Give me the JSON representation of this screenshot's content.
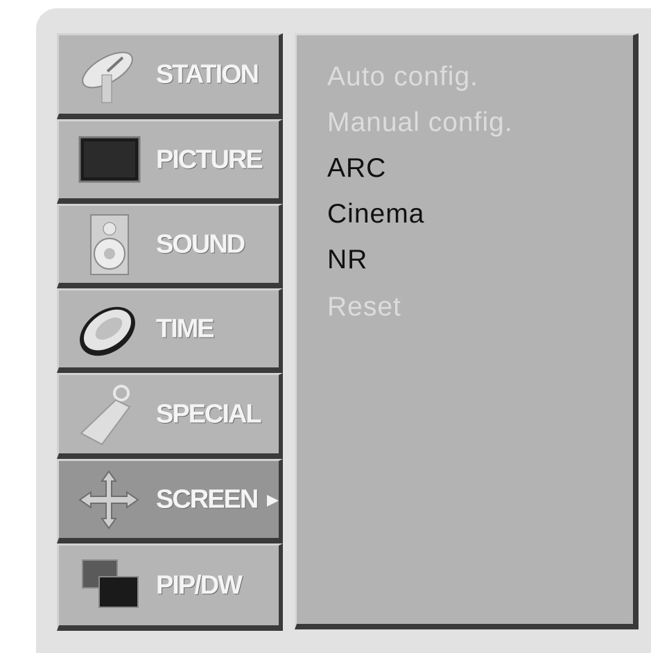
{
  "main_menu": {
    "items": [
      {
        "label": "STATION",
        "icon": "satellite-dish-icon"
      },
      {
        "label": "PICTURE",
        "icon": "tv-screen-icon"
      },
      {
        "label": "SOUND",
        "icon": "speaker-icon"
      },
      {
        "label": "TIME",
        "icon": "clock-icon"
      },
      {
        "label": "SPECIAL",
        "icon": "tag-icon"
      },
      {
        "label": "SCREEN",
        "icon": "move-arrows-icon",
        "selected": true,
        "arrow": "▶"
      },
      {
        "label": "PIP/DW",
        "icon": "pip-windows-icon"
      }
    ]
  },
  "submenu": {
    "items": [
      {
        "label": "Auto config.",
        "enabled": false
      },
      {
        "label": "Manual config.",
        "enabled": false
      },
      {
        "label": "ARC",
        "enabled": true
      },
      {
        "label": "Cinema",
        "enabled": true
      },
      {
        "label": "NR",
        "enabled": true
      },
      {
        "label": "Reset",
        "enabled": false
      }
    ]
  },
  "colors": {
    "panel": "#b3b3b3",
    "selected": "#959595",
    "shadow": "#3a3a3a",
    "enabled_text": "#111111",
    "disabled_text": "#dcdcdc"
  }
}
